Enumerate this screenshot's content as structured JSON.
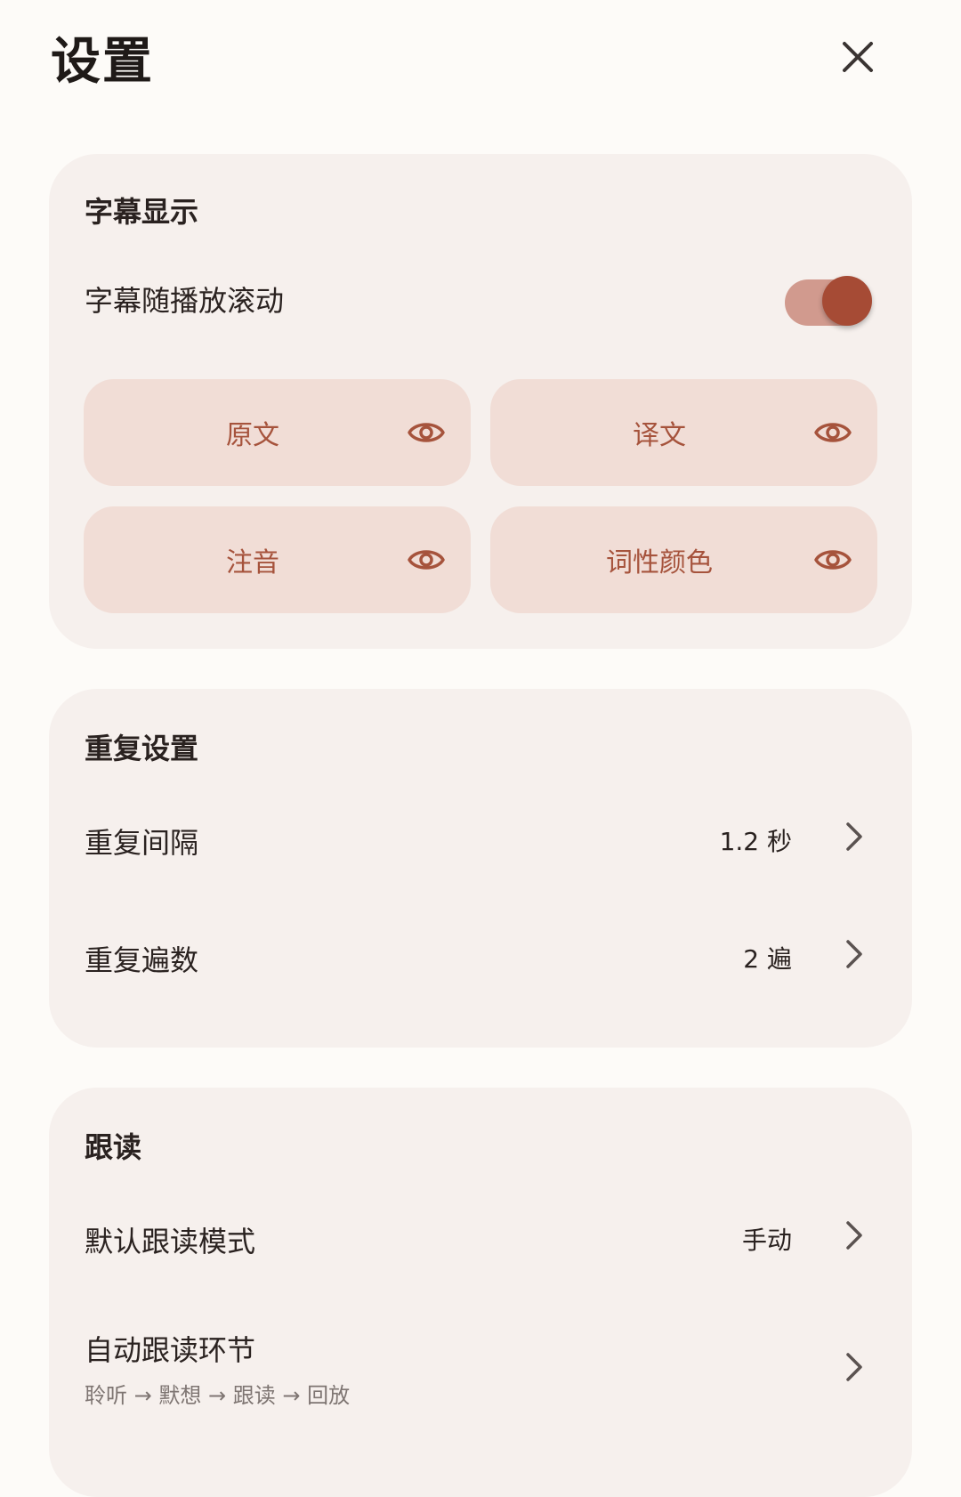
{
  "header": {
    "title": "设置",
    "close_icon": "close-icon"
  },
  "colors": {
    "accent": "#a64b35",
    "chip_bg": "#f1ddd6",
    "card_bg": "#f6f0ed",
    "page_bg": "#fdfbf8"
  },
  "subtitle_section": {
    "title": "字幕显示",
    "scroll_toggle": {
      "label": "字幕随播放滚动",
      "on": true
    },
    "chips": [
      {
        "label": "原文",
        "icon": "eye-icon"
      },
      {
        "label": "译文",
        "icon": "eye-icon"
      },
      {
        "label": "注音",
        "icon": "eye-icon"
      },
      {
        "label": "词性颜色",
        "icon": "eye-icon"
      }
    ]
  },
  "repeat_section": {
    "title": "重复设置",
    "interval": {
      "label": "重复间隔",
      "value": "1.2 秒"
    },
    "count": {
      "label": "重复遍数",
      "value": "2 遍"
    }
  },
  "follow_section": {
    "title": "跟读",
    "default_mode": {
      "label": "默认跟读模式",
      "value": "手动"
    },
    "auto_steps": {
      "label": "自动跟读环节",
      "sub": "聆听 → 默想 → 跟读 → 回放"
    }
  }
}
